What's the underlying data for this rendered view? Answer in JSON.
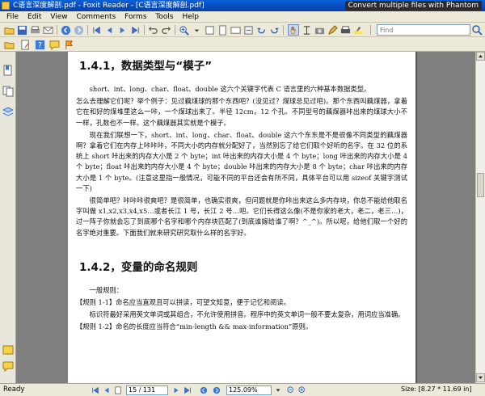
{
  "titlebar": {
    "title": "C语言深度解剖.pdf - Foxit Reader - [C语言深度解剖.pdf]",
    "promo": "Convert multiple files with Phantom"
  },
  "menu": [
    {
      "label": "File",
      "ul": "F"
    },
    {
      "label": "Edit",
      "ul": "E"
    },
    {
      "label": "View",
      "ul": "V"
    },
    {
      "label": "Comments",
      "ul": "C"
    },
    {
      "label": "Forms",
      "ul": "F"
    },
    {
      "label": "Tools",
      "ul": "T"
    },
    {
      "label": "Help",
      "ul": "H"
    }
  ],
  "find": {
    "placeholder": "Find"
  },
  "document": {
    "heading1": "1.4.1，数据类型与“模子”",
    "p1": "short、int、long、char、float、double 这六个关键字代表 C 语言里的六种基本数据类型。",
    "p2": "怎么去理解它们呢？举个例子：见过藕煤球的那个东西吧？(没见过？煤球总见过吧)。那个东西叫藕煤器，拿着它在和好的煤堆里这么一咔，一个煤球出来了。半径 12cm，12 个孔。不同型号的藕煤器咔出来的煤球大小不一样，孔数也不一样。这个藕煤器其实就是个模子。",
    "p3": "现在我们联想一下，short、int、long、char、float、double 这六个东东是不是很像不同类型的藕煤器啊？拿着它们在内存上咔咔咔，不同大小的内存就分配好了，当然别忘了给它们取个好听的名字。在 32 位的系统上 short 咔出来的内存大小是 2 个 byte；int 咔出来的内存大小是 4 个 byte；long 咔出来的内存大小是 4 个 byte；float 咔出来的内存大小是 4 个 byte；double 咔出来的内存大小是 8 个 byte；char 咔出来的内存大小是 1 个 byte。(注意这里指一般情况，可能不同的平台还会有所不同，具体平台可以用 sizeof 关键字测试一下)",
    "p4": "很简单吧？咔咔咔很爽吧？是很简单，也确实很爽，但问题就是你咔出来这么多内存块，你总不能给他取名字叫做 x1,x2,x3,x4,x5…或者长江 1 号，长江 2 号…吧。它们长得这么像(不是你家的老大，老二，老三…)，过一阵子你就会忘了到底哪个名字和哪个内存块匹配了(到底谁嫁给谁了啊？^_^)。所以呢，给他们取一个好的名字绝对重要。下面我们就来研究研究取什么样的名字好。",
    "heading2": "1.4.2，变量的命名规则",
    "p5": "一般规则：",
    "p6": "【规则 1-1】命名应当直观且可以拼读，可望文知意，便于记忆和阅读。",
    "p7": "标识符最好采用英文单词或其组合，不允许使用拼音。程序中的英文单词一般不要太复杂，用词应当准确。",
    "p8": "【规则 1-2】命名的长度应当符合“min-length && max-information”原则。"
  },
  "status": {
    "ready": "Ready",
    "page": "15 / 131",
    "zoom": "125.09%",
    "size": "Size: [8.27 * 11.69 in]"
  },
  "colors": {
    "titlebar": "#0a5fd8",
    "chrome": "#ece9d8",
    "viewer_bg": "#7f7f7f"
  }
}
